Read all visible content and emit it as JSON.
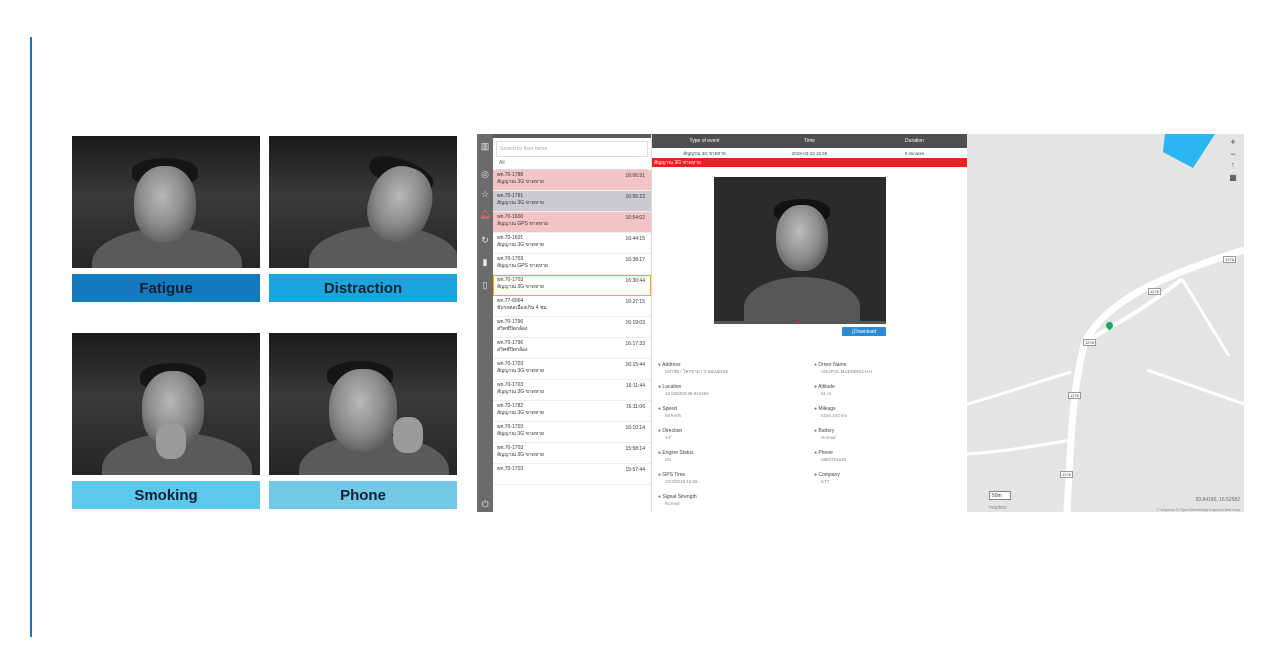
{
  "behaviors": [
    {
      "label": "Fatigue",
      "color": "#1479bd"
    },
    {
      "label": "Distraction",
      "color": "#1aa6dc"
    },
    {
      "label": "Smoking",
      "color": "#5ec7ee"
    },
    {
      "label": "Phone",
      "color": "#73c8e8"
    }
  ],
  "app": {
    "search_placeholder": "Search by fleet name",
    "filter_value": "All",
    "vehicles": [
      {
        "plate": "wn.70-1788",
        "event": "สัญญาณ 3G ขาดหาย",
        "time": "16:06:51",
        "state": "red"
      },
      {
        "plate": "wn.70-1791",
        "event": "สัญญาณ 3G ขาดหาย",
        "time": "16:56:23",
        "state": "grey"
      },
      {
        "plate": "wn.70-1600",
        "event": "สัญญาณ GPS ขาดหาย",
        "time": "16:54:02",
        "state": "red"
      },
      {
        "plate": "wn.70-1601",
        "event": "สัญญาณ 3G ขาดหาย",
        "time": "16:44:15",
        "state": "normal"
      },
      {
        "plate": "wn.70-1703",
        "event": "สัญญาณ GPS ขาดหาย",
        "time": "16:38:17",
        "state": "normal"
      },
      {
        "plate": "wn.70-1703",
        "event": "สัญญาณ 3G ขาดหาย",
        "time": "16:30:44",
        "state": "selected"
      },
      {
        "plate": "wn.77-6064",
        "event": "ขับรถต่อเนื่องเกิน 4 ชม.",
        "time": "16:27:15",
        "state": "normal"
      },
      {
        "plate": "wn.70-1796",
        "event": "สวิตช์ปิดกล้อง",
        "time": "16:19:03",
        "state": "normal"
      },
      {
        "plate": "wn.70-1796",
        "event": "สวิตช์ปิดกล้อง",
        "time": "16:17:33",
        "state": "normal"
      },
      {
        "plate": "wn.70-1703",
        "event": "สัญญาณ 3G ขาดหาย",
        "time": "16:15:44",
        "state": "normal"
      },
      {
        "plate": "wn.70-1703",
        "event": "สัญญาณ 3G ขาดหาย",
        "time": "16:11:44",
        "state": "normal"
      },
      {
        "plate": "wn.70-1782",
        "event": "สัญญาณ 3G ขาดหาย",
        "time": "16:11:06",
        "state": "normal"
      },
      {
        "plate": "wn.70-1703",
        "event": "สัญญาณ 3G ขาดหาย",
        "time": "16:10:14",
        "state": "normal"
      },
      {
        "plate": "wn.70-1703",
        "event": "สัญญาณ 3G ขาดหาย",
        "time": "15:58:14",
        "state": "normal"
      },
      {
        "plate": "wn.70-1703",
        "event": "",
        "time": "15:57:44",
        "state": "normal"
      }
    ],
    "table": {
      "headers": [
        "Type of event",
        "Time",
        "Duration"
      ],
      "row": [
        "สัญญาณ 3G ขาดหาย",
        "2019-03-22 16:55",
        "0 minutes"
      ]
    },
    "alert": "สัญญาณ 3G ขาดหาย",
    "download_label": "⤓Download",
    "info_left": [
      {
        "key": "Address",
        "value": "มหาชัย / โคกขาม / ถ.นมเนยเขต",
        "icon": "home-icon"
      },
      {
        "key": "Location",
        "value": "16.525303,99.844455",
        "icon": "pin-icon"
      },
      {
        "key": "Speed",
        "value": "55 km/h",
        "icon": "gauge-icon"
      },
      {
        "key": "Direction",
        "value": "44°",
        "icon": "compass-icon"
      },
      {
        "key": "Engine Status",
        "value": "On",
        "icon": "car-icon"
      },
      {
        "key": "GPS Time",
        "value": "22/3/2019 16:55",
        "icon": "clock-icon"
      },
      {
        "key": "Signal Strength",
        "value": "Normal",
        "icon": "signal-icon"
      }
    ],
    "info_right": [
      {
        "key": "Driver Name",
        "value": "ANUPOL MUENBRICHAI",
        "icon": "person-icon"
      },
      {
        "key": "Altitude",
        "value": "51 m",
        "icon": "mountain-icon"
      },
      {
        "key": "Mileage",
        "value": "5164.243 km",
        "icon": "odometer-icon"
      },
      {
        "key": "Battery",
        "value": "Normal",
        "icon": "battery-icon"
      },
      {
        "key": "Phone",
        "value": "0862791640",
        "icon": "phone-icon"
      },
      {
        "key": "Company",
        "value": "KTT",
        "icon": "building-icon"
      }
    ]
  },
  "map": {
    "road_labels": [
      "1278",
      "1278",
      "1278",
      "1278",
      "1278"
    ],
    "scale": "50m",
    "coords": "99.84180, 16.52582",
    "attribution": "© Mapbox © OpenStreetMap Improve this map",
    "brand": "mapbox",
    "marker_color": "#1fa85a",
    "zone_color": "#2ab6f0"
  }
}
